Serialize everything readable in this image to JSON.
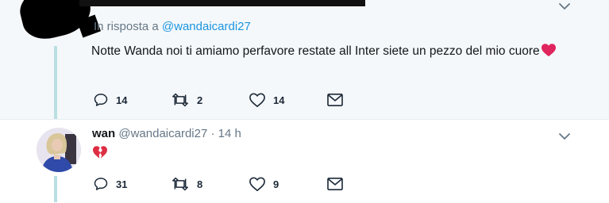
{
  "tweet1": {
    "reply_prefix": "In risposta a ",
    "reply_mention": "@wandaicardi27",
    "text": "Notte Wanda noi ti amiamo perfavore restate all Inter siete un pezzo del mio cuore",
    "replies": "14",
    "retweets": "2",
    "likes": "14"
  },
  "tweet2": {
    "display_name": "wan",
    "handle": "@wandaicardi27",
    "separator": " · ",
    "time": "14 h",
    "emoji": "broken-heart-icon",
    "replies": "31",
    "retweets": "8",
    "likes": "9"
  },
  "colors": {
    "accent": "#1b95e0",
    "muted": "#657786",
    "thread_line": "#b9dfe3",
    "highlight_bg": "#f5f8fa",
    "heart": "#e0245e"
  }
}
